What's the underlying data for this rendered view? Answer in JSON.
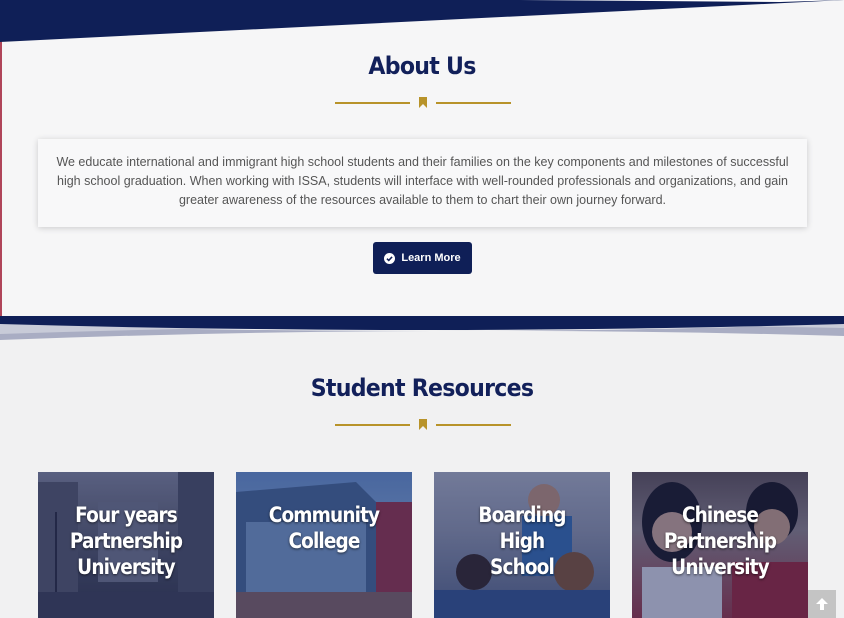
{
  "about": {
    "title": "About Us",
    "body": "We educate international and immigrant high school students and their families on the key components and milestones of successful high school graduation. When working with ISSA, students will interface with well-rounded professionals and organizations, and gain greater awareness of the resources available to them to chart their own journey forward.",
    "button_label": "Learn More"
  },
  "resources": {
    "title": "Student Resources",
    "cards": [
      {
        "label": "Four years\nPartnership\nUniversity"
      },
      {
        "label": "Community\nCollege"
      },
      {
        "label": "Boarding\nHigh\nSchool"
      },
      {
        "label": "Chinese\nPartnership\nUniversity"
      }
    ]
  },
  "colors": {
    "navy": "#0f1f57",
    "gold": "#b8932a",
    "text": "#555555",
    "background": "#f6f6f7"
  },
  "icons": {
    "learn_more": "check-circle-icon",
    "scroll_top": "arrow-up-icon",
    "divider_mark": "bookmark-icon"
  }
}
